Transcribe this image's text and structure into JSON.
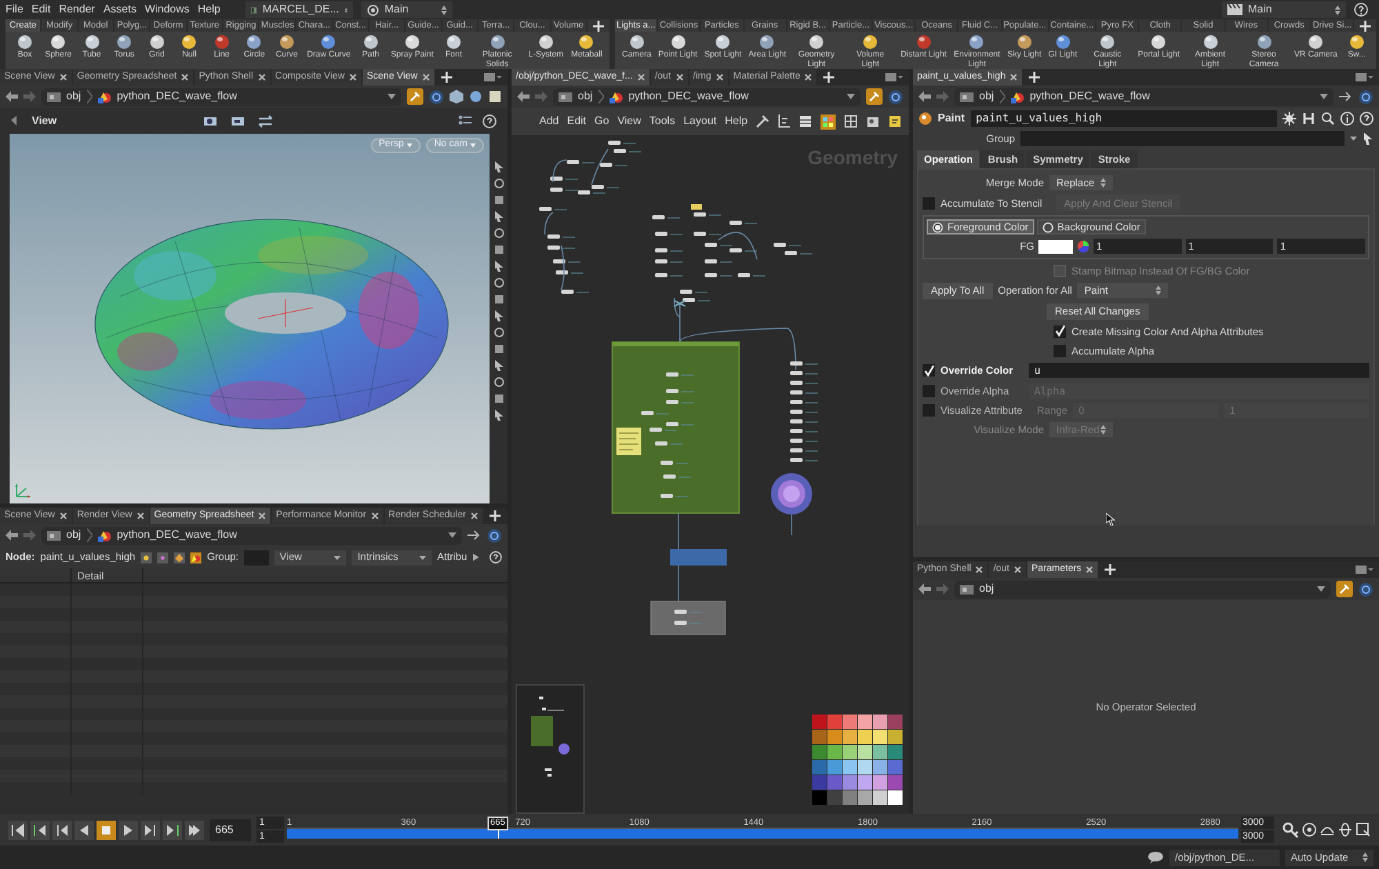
{
  "menu_bar": {
    "items": [
      "File",
      "Edit",
      "Render",
      "Assets",
      "Windows",
      "Help"
    ],
    "desktop": "MARCEL_DE...",
    "context": "Main",
    "right_context": "Main"
  },
  "shelf_left": {
    "tabs": [
      {
        "label": "Create",
        "selected": true
      },
      {
        "label": "Modify",
        "selected": false
      },
      {
        "label": "Model",
        "selected": false
      },
      {
        "label": "Polyg...",
        "selected": false
      },
      {
        "label": "Deform",
        "selected": false
      },
      {
        "label": "Texture",
        "selected": false
      },
      {
        "label": "Rigging",
        "selected": false
      },
      {
        "label": "Muscles",
        "selected": false
      },
      {
        "label": "Chara...",
        "selected": false
      },
      {
        "label": "Const...",
        "selected": false
      },
      {
        "label": "Hair...",
        "selected": false
      },
      {
        "label": "Guide...",
        "selected": false
      },
      {
        "label": "Guid...",
        "selected": false
      },
      {
        "label": "Terra...",
        "selected": false
      },
      {
        "label": "Clou...",
        "selected": false
      },
      {
        "label": "Volume",
        "selected": false
      }
    ],
    "tools": [
      "Box",
      "Sphere",
      "Tube",
      "Torus",
      "Grid",
      "Null",
      "Line",
      "Circle",
      "Curve",
      "Draw Curve",
      "Path",
      "Spray Paint",
      "Font",
      "Platonic Solids",
      "L-System",
      "Metaball"
    ]
  },
  "shelf_right": {
    "tabs": [
      {
        "label": "Lights a...",
        "selected": true
      },
      {
        "label": "Collisions",
        "selected": false
      },
      {
        "label": "Particles",
        "selected": false
      },
      {
        "label": "Grains",
        "selected": false
      },
      {
        "label": "Rigid B...",
        "selected": false
      },
      {
        "label": "Particle...",
        "selected": false
      },
      {
        "label": "Viscous...",
        "selected": false
      },
      {
        "label": "Oceans",
        "selected": false
      },
      {
        "label": "Fluid C...",
        "selected": false
      },
      {
        "label": "Populate...",
        "selected": false
      },
      {
        "label": "Containe...",
        "selected": false
      },
      {
        "label": "Pyro FX",
        "selected": false
      },
      {
        "label": "Cloth",
        "selected": false
      },
      {
        "label": "Solid",
        "selected": false
      },
      {
        "label": "Wires",
        "selected": false
      },
      {
        "label": "Crowds",
        "selected": false
      },
      {
        "label": "Drive Si...",
        "selected": false
      }
    ],
    "tools": [
      "Camera",
      "Point Light",
      "Spot Light",
      "Area Light",
      "Geometry Light",
      "Volume Light",
      "Distant Light",
      "Environment Light",
      "Sky Light",
      "GI Light",
      "Caustic Light",
      "Portal Light",
      "Ambient Light",
      "Stereo Camera",
      "VR Camera",
      "Sw..."
    ]
  },
  "scene_pane": {
    "tabs": [
      {
        "label": "Scene View",
        "selected": false
      },
      {
        "label": "Geometry Spreadsheet",
        "selected": false
      },
      {
        "label": "Python Shell",
        "selected": false
      },
      {
        "label": "Composite View",
        "selected": false
      },
      {
        "label": "Scene View",
        "selected": true
      }
    ],
    "path_root": "obj",
    "path_node": "python_DEC_wave_flow",
    "view_label": "View",
    "camera_buttons": [
      "Persp",
      "No cam"
    ]
  },
  "spreadsheet_pane": {
    "tabs": [
      {
        "label": "Scene View",
        "selected": false
      },
      {
        "label": "Render View",
        "selected": false
      },
      {
        "label": "Geometry Spreadsheet",
        "selected": true
      },
      {
        "label": "Performance Monitor",
        "selected": false
      },
      {
        "label": "Render Scheduler",
        "selected": false
      }
    ],
    "path_root": "obj",
    "path_node": "python_DEC_wave_flow",
    "node_label": "Node:",
    "node_name": "paint_u_values_high",
    "group_label": "Group:",
    "view_menu": "View",
    "intrinsics_menu": "Intrinsics",
    "attribs_label": "Attribu",
    "column": "Detail"
  },
  "network_pane": {
    "tabs": [
      {
        "label": "/obj/python_DEC_wave_f...",
        "selected": true
      },
      {
        "label": "/out",
        "selected": false
      },
      {
        "label": "/img",
        "selected": false
      },
      {
        "label": "Material Palette",
        "selected": false
      }
    ],
    "path_root": "obj",
    "path_node": "python_DEC_wave_flow",
    "menu": [
      "Add",
      "Edit",
      "Go",
      "View",
      "Tools",
      "Layout",
      "Help"
    ],
    "context_label": "Geometry"
  },
  "parameters_pane": {
    "tabs": [
      {
        "label": "paint_u_values_high",
        "selected": true
      }
    ],
    "path_root": "obj",
    "path_node": "python_DEC_wave_flow",
    "node_type": "Paint",
    "node_name": "paint_u_values_high",
    "group_label": "Group",
    "param_tabs": [
      {
        "label": "Operation",
        "selected": true
      },
      {
        "label": "Brush",
        "selected": false
      },
      {
        "label": "Symmetry",
        "selected": false
      },
      {
        "label": "Stroke",
        "selected": false
      }
    ],
    "params": [
      {
        "kind": "menu",
        "label": "Merge Mode",
        "value": "Replace",
        "disabled": false
      },
      {
        "kind": "checkbox_button",
        "label": "Accumulate To Stencil",
        "checked": false,
        "button": "Apply And Clear Stencil",
        "disabled": true
      },
      {
        "kind": "radio",
        "options": [
          {
            "label": "Foreground Color",
            "selected": true
          },
          {
            "label": "Background Color",
            "selected": false
          }
        ],
        "color_label": "FG",
        "values": [
          "1",
          "1",
          "1"
        ]
      },
      {
        "kind": "check",
        "label": "Stamp Bitmap Instead Of FG/BG Color",
        "checked": false,
        "disabled": true
      },
      {
        "kind": "button_menu",
        "button": "Apply To All",
        "label": "Operation for All",
        "value": "Paint"
      },
      {
        "kind": "button",
        "button": "Reset All Changes"
      },
      {
        "kind": "check",
        "label": "Create Missing Color And Alpha Attributes",
        "checked": true,
        "disabled": false
      },
      {
        "kind": "check",
        "label": "Accumulate Alpha",
        "checked": false,
        "disabled": false
      },
      {
        "kind": "toggle_field",
        "label": "Override Color",
        "checked": true,
        "value": "u"
      },
      {
        "kind": "toggle_field",
        "label": "Override Alpha",
        "checked": false,
        "value": "Alpha"
      },
      {
        "kind": "toggle_range",
        "label": "Visualize Attribute",
        "checked": false,
        "range_label": "Range",
        "values": [
          "0",
          "1"
        ]
      },
      {
        "kind": "menu",
        "label": "Visualize Mode",
        "value": "Infra-Red",
        "disabled": true
      }
    ]
  },
  "lower_right_pane": {
    "tabs": [
      {
        "label": "Python Shell",
        "selected": false
      },
      {
        "label": "/out",
        "selected": false
      },
      {
        "label": "Parameters",
        "selected": true
      }
    ],
    "path_root": "obj",
    "message": "No Operator Selected"
  },
  "timeline": {
    "transport": [
      {
        "kind": "first",
        "selected": false
      },
      {
        "kind": "prev_key",
        "selected": false
      },
      {
        "kind": "step_back",
        "selected": false
      },
      {
        "kind": "reverse",
        "selected": false
      },
      {
        "kind": "stop",
        "selected": true
      },
      {
        "kind": "play",
        "selected": false
      },
      {
        "kind": "step_forward",
        "selected": false
      },
      {
        "kind": "next_key",
        "selected": false
      },
      {
        "kind": "last",
        "selected": false
      }
    ],
    "frame": "665",
    "range_start": [
      "1",
      "1"
    ],
    "ticks": [
      "1",
      "360",
      "720",
      "1080",
      "1440",
      "1800",
      "2160",
      "2520",
      "2880"
    ],
    "playhead": {
      "label": "665",
      "level": 0.2217
    },
    "range_end": [
      "3000",
      "3000"
    ]
  },
  "status_bar": {
    "path": "/obj/python_DE...",
    "update_mode": "Auto Update"
  }
}
